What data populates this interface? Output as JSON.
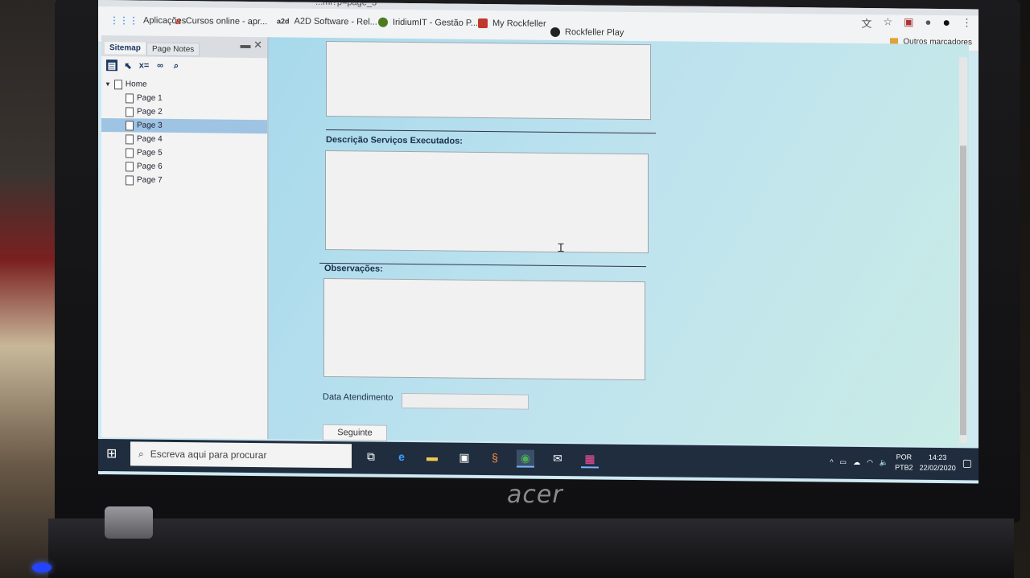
{
  "browser": {
    "tab_fragment": "...ml?p=page_3",
    "bookmarks": [
      {
        "label": "Aplicações",
        "icon": "apps-grid-icon",
        "color": "#1a73e8"
      },
      {
        "label": "Cursos online - apr...",
        "icon": "cursos-logo-icon",
        "color": "#c0392b"
      },
      {
        "label": "A2D Software - Rel...",
        "icon": "a2d-logo-icon",
        "color": "#333333"
      },
      {
        "label": "IridiumIT - Gestão P...",
        "icon": "iridium-logo-icon",
        "color": "#4c7a1e"
      },
      {
        "label": "My Rockfeller",
        "icon": "rockfeller-logo-icon",
        "color": "#c0392b"
      },
      {
        "label": "Rockfeller Play",
        "icon": "rockfeller-play-icon",
        "color": "#222222"
      }
    ],
    "other_bookmarks": "Outros marcadores"
  },
  "sidebar": {
    "tabs": [
      "Sitemap",
      "Page Notes"
    ],
    "tree": {
      "root": "Home",
      "pages": [
        "Page 1",
        "Page 2",
        "Page 3",
        "Page 4",
        "Page 5",
        "Page 6",
        "Page 7"
      ],
      "selected": "Page 3"
    }
  },
  "form": {
    "descricao_label": "Descrição Serviços Executados:",
    "observacoes_label": "Observações:",
    "data_label": "Data Atendimento",
    "data_value": "",
    "next_button": "Seguinte"
  },
  "taskbar": {
    "search_placeholder": "Escreva aqui para procurar",
    "lang_top": "POR",
    "lang_bottom": "PTB2",
    "time": "14:23",
    "date": "22/02/2020"
  },
  "device": {
    "brand": "acer"
  },
  "colors": {
    "selected_row": "#9fc3e2",
    "taskbar": "#1f2d3f",
    "content_bg": "#bfe3ee"
  }
}
